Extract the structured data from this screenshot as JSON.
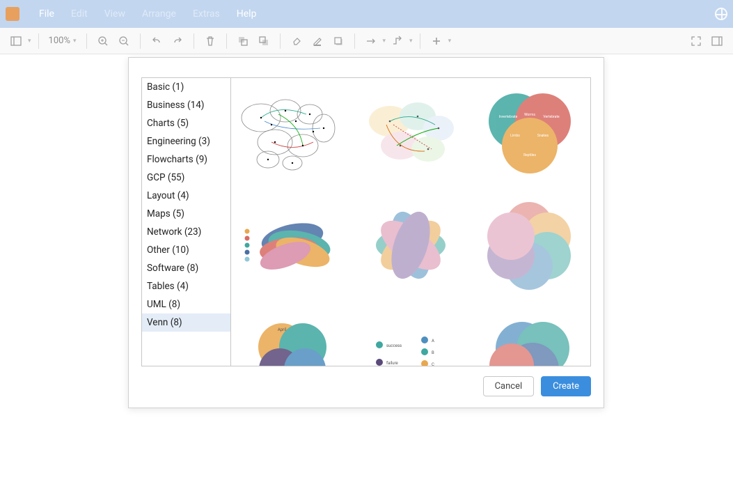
{
  "menubar": {
    "items": [
      {
        "label": "File",
        "disabled": false
      },
      {
        "label": "Edit",
        "disabled": true
      },
      {
        "label": "View",
        "disabled": true
      },
      {
        "label": "Arrange",
        "disabled": true
      },
      {
        "label": "Extras",
        "disabled": true
      },
      {
        "label": "Help",
        "disabled": false
      }
    ]
  },
  "toolbar": {
    "zoom": "100%"
  },
  "dialog": {
    "categories": [
      {
        "label": "Basic (1)",
        "selected": false
      },
      {
        "label": "Business (14)",
        "selected": false
      },
      {
        "label": "Charts (5)",
        "selected": false
      },
      {
        "label": "Engineering (3)",
        "selected": false
      },
      {
        "label": "Flowcharts (9)",
        "selected": false
      },
      {
        "label": "GCP (55)",
        "selected": false
      },
      {
        "label": "Layout (4)",
        "selected": false
      },
      {
        "label": "Maps (5)",
        "selected": false
      },
      {
        "label": "Network (23)",
        "selected": false
      },
      {
        "label": "Other (10)",
        "selected": false
      },
      {
        "label": "Software (8)",
        "selected": false
      },
      {
        "label": "Tables (4)",
        "selected": false
      },
      {
        "label": "UML (8)",
        "selected": false
      },
      {
        "label": "Venn (8)",
        "selected": true
      }
    ],
    "cancel_label": "Cancel",
    "create_label": "Create"
  },
  "palette": {
    "teal": "#3fa8a0",
    "red": "#d96b63",
    "orange": "#e9a74e",
    "blue": "#4f8fbf",
    "purple": "#8b6fa8",
    "pink": "#d88aa8",
    "dkblue": "#4a6fa5",
    "grey": "#7a7a7a"
  }
}
